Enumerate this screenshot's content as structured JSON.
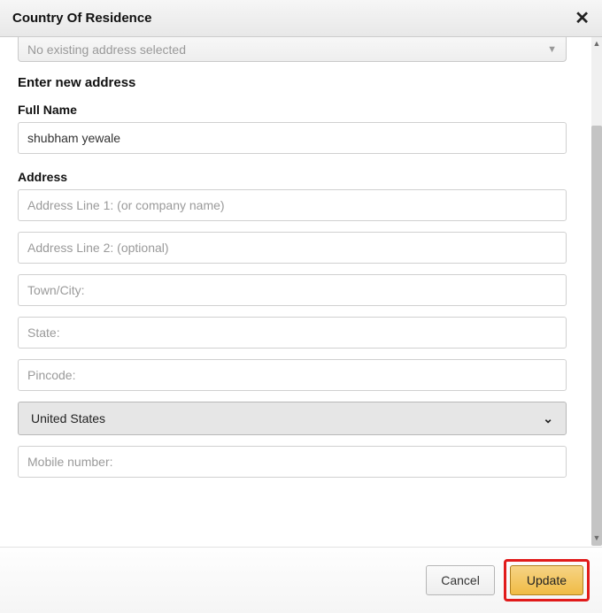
{
  "header": {
    "title": "Country Of Residence"
  },
  "existing_address": {
    "selected": "No existing address selected"
  },
  "section": {
    "heading": "Enter new address"
  },
  "fields": {
    "full_name_label": "Full Name",
    "full_name_value": "shubham yewale",
    "address_label": "Address",
    "line1_placeholder": "Address Line 1: (or company name)",
    "line2_placeholder": "Address Line 2: (optional)",
    "city_placeholder": "Town/City:",
    "state_placeholder": "State:",
    "pincode_placeholder": "Pincode:",
    "country_value": "United States",
    "mobile_placeholder": "Mobile number:"
  },
  "footer": {
    "cancel": "Cancel",
    "update": "Update"
  }
}
